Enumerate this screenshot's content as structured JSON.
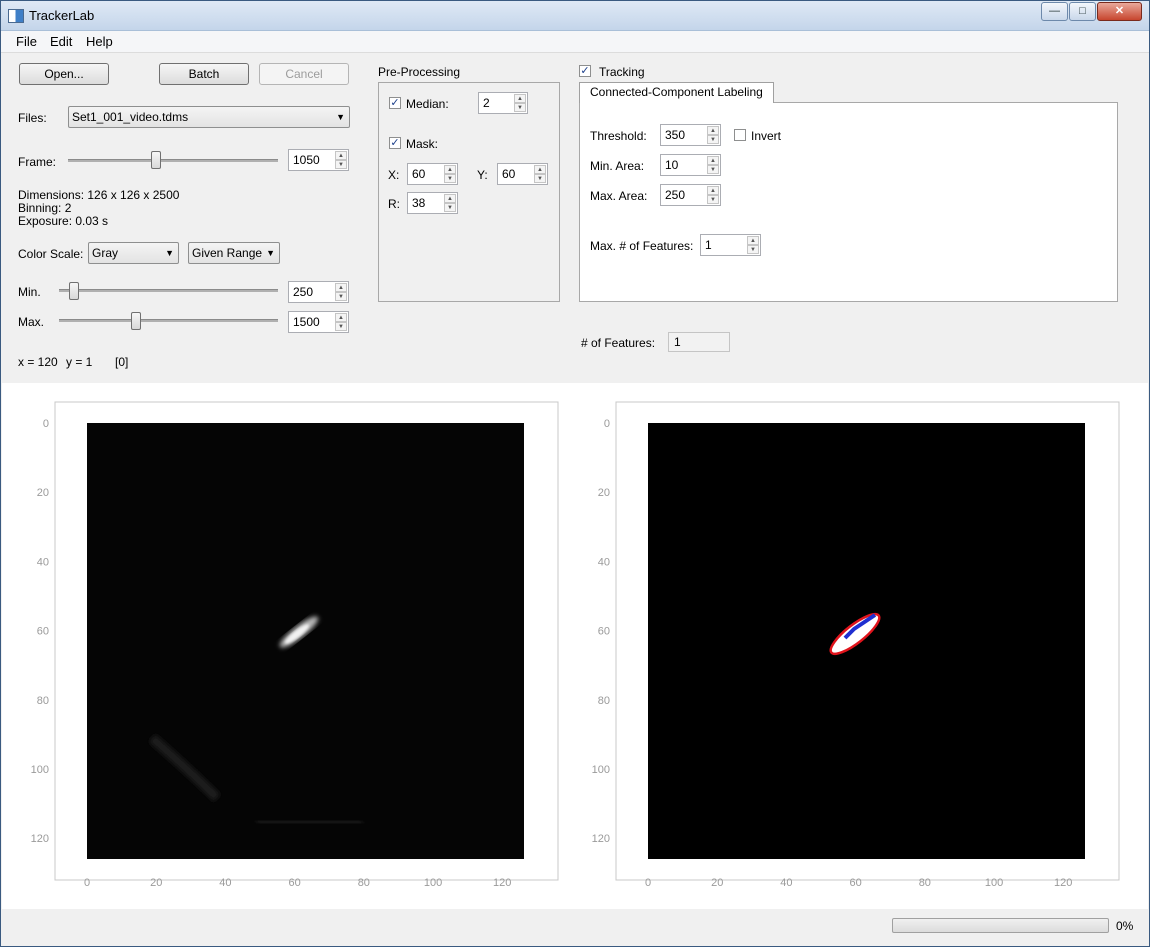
{
  "window": {
    "title": "TrackerLab",
    "controls": [
      "—",
      "□",
      "✕"
    ]
  },
  "menu": [
    "File",
    "Edit",
    "Help"
  ],
  "toolbar": {
    "open": "Open...",
    "batch": "Batch",
    "cancel": "Cancel"
  },
  "files": {
    "label": "Files:",
    "value": "Set1_001_video.tdms"
  },
  "frame": {
    "label": "Frame:",
    "value": "1050",
    "slider_fraction": 0.42
  },
  "info": {
    "dimensions": "Dimensions: 126 x 126 x 2500",
    "binning": "Binning: 2",
    "exposure": "Exposure: 0.03 s"
  },
  "color_scale": {
    "label": "Color Scale:",
    "map": "Gray",
    "range": "Given Range"
  },
  "min": {
    "label": "Min.",
    "value": "250",
    "slider_fraction": 0.07
  },
  "max": {
    "label": "Max.",
    "value": "1500",
    "slider_fraction": 0.35
  },
  "cursor": {
    "x": "x = 120",
    "y": "y = 1",
    "val": "[0]"
  },
  "preprocessing": {
    "title": "Pre-Processing",
    "median_label": "Median:",
    "median_checked": true,
    "median_value": "2",
    "mask_label": "Mask:",
    "mask_checked": true,
    "x_label": "X:",
    "x_value": "60",
    "y_label": "Y:",
    "y_value": "60",
    "r_label": "R:",
    "r_value": "38"
  },
  "tracking": {
    "label": "Tracking",
    "checked": true,
    "tab": "Connected-Component Labeling",
    "threshold_label": "Threshold:",
    "threshold_value": "350",
    "invert_label": "Invert",
    "invert_checked": false,
    "min_area_label": "Min. Area:",
    "min_area_value": "10",
    "max_area_label": "Max. Area:",
    "max_area_value": "250",
    "max_features_label": "Max. # of Features:",
    "max_features_value": "1",
    "features_label": "# of Features:",
    "features_value": "1"
  },
  "plots": {
    "y_ticks": [
      "0",
      "20",
      "40",
      "60",
      "80",
      "100",
      "120"
    ],
    "x_ticks": [
      "0",
      "20",
      "40",
      "60",
      "80",
      "100",
      "120"
    ]
  },
  "progress": {
    "value": 0,
    "label": "0%"
  }
}
